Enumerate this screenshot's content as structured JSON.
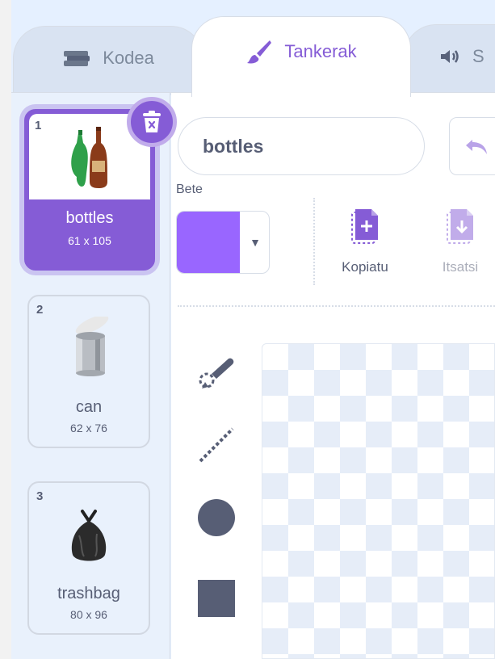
{
  "tabs": {
    "code_label": "Kodea",
    "costumes_label": "Tankerak",
    "sounds_label": "S"
  },
  "costumes": [
    {
      "number": "1",
      "name": "bottles",
      "size": "61 x 105",
      "selected": true,
      "icon": "bottles-icon"
    },
    {
      "number": "2",
      "name": "can",
      "size": "62 x 76",
      "selected": false,
      "icon": "can-icon"
    },
    {
      "number": "3",
      "name": "trashbag",
      "size": "80 x 96",
      "selected": false,
      "icon": "trashbag-icon"
    }
  ],
  "editor": {
    "costume_name": "bottles",
    "fill_label": "Bete",
    "copy_label": "Kopiatu",
    "paste_label": "Itsatsi"
  },
  "tools": [
    "reshape-icon",
    "line-icon",
    "circle-icon",
    "rectangle-icon"
  ],
  "colors": {
    "accent": "#855cd6",
    "fill": "#9966ff",
    "text": "#575e75",
    "tool": "#575e75",
    "tab_inactive_text": "#7d8a9c"
  }
}
